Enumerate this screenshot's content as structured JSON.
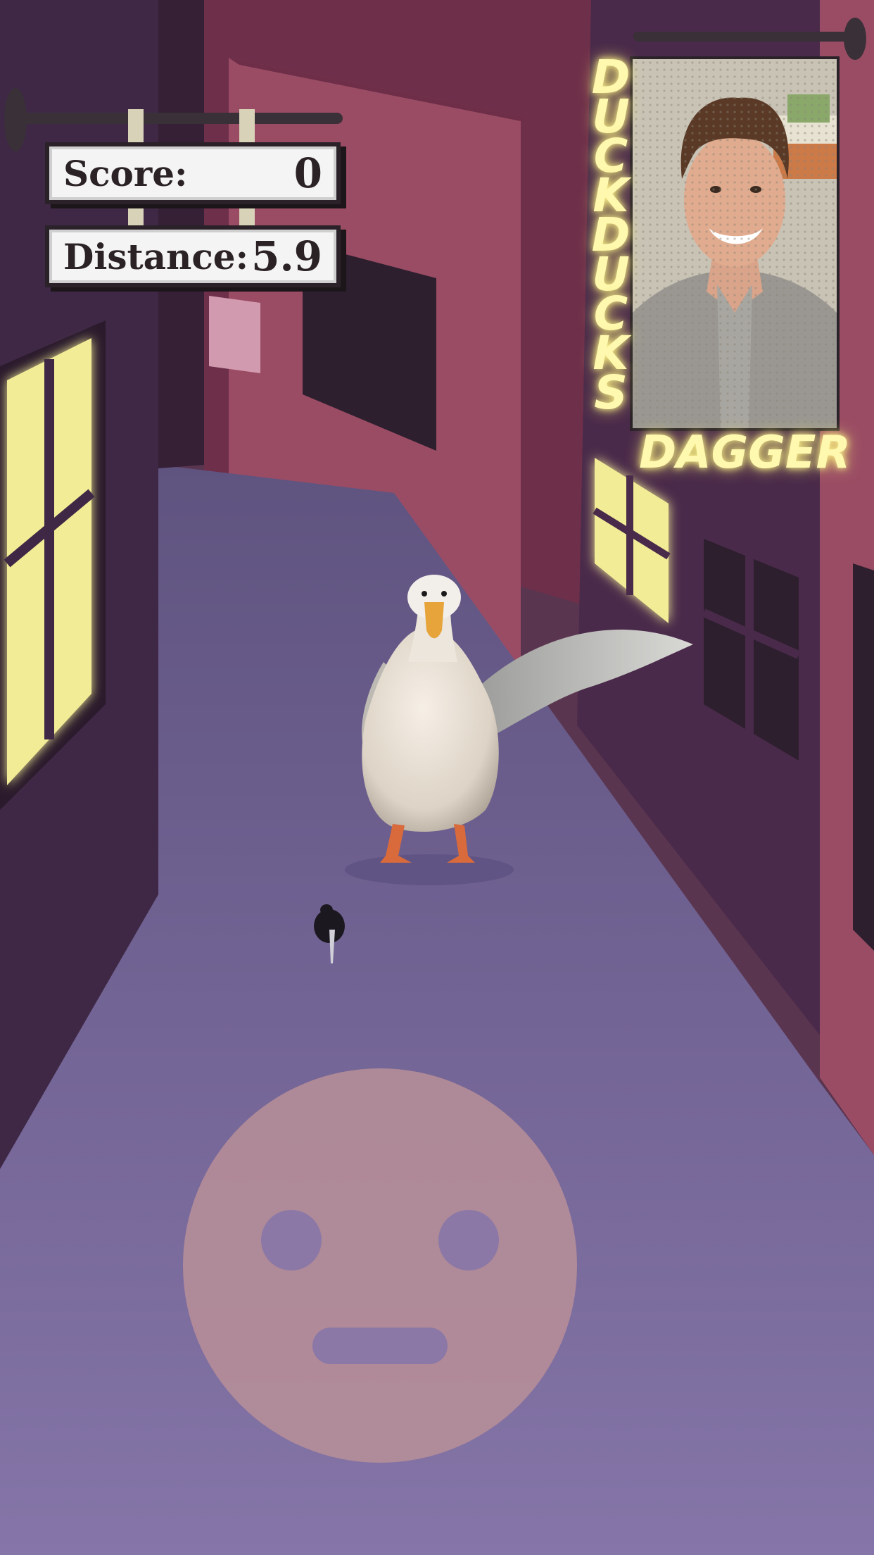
{
  "hud": {
    "score_label": "Score:",
    "score_value": "0",
    "distance_label": "Distance:",
    "distance_value": "5.9"
  },
  "opponent_card": {
    "name_vertical": "DUCK DUCKS",
    "name_horizontal": "DAGGER"
  },
  "colors": {
    "alley_floor": "#7b6f9c",
    "left_wall": "#3f2845",
    "right_wall": "#4a2a4a",
    "back_building": "#8c3e5c",
    "window_glow": "#f2ec96",
    "neon_text": "#fff9b0",
    "face_button": "#b88f98"
  },
  "icons": [
    "duck-character",
    "dagger-icon",
    "face-control-button",
    "opponent-portrait"
  ]
}
